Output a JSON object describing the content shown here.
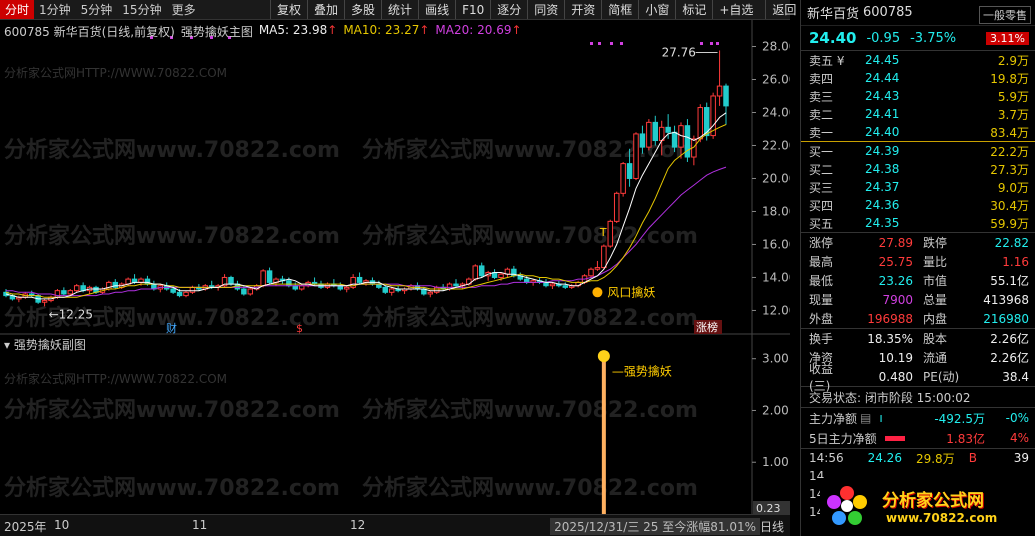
{
  "toolbar": {
    "periods": [
      "分时",
      "1分钟",
      "5分钟",
      "15分钟",
      "更多"
    ],
    "buttons": [
      "复权",
      "叠加",
      "多股",
      "统计",
      "画线",
      "F10",
      "逐分",
      "同资",
      "开资",
      "简框",
      "小窗",
      "标记",
      "+自选",
      "返回"
    ]
  },
  "chart": {
    "stock_label": "600785  新华百货(日线,前复权)",
    "formula_label": "强势擒妖主图",
    "ma5_label": "MA5: 23.98",
    "ma10_label": "MA10: 23.27",
    "ma20_label": "MA20: 20.69",
    "arrow": "↑",
    "high_label": "27.76",
    "low_label": "12.25",
    "signal_main": "风口擒妖",
    "signal_sub": "强势擒妖",
    "marker_t": "T",
    "sub_title": "强势擒妖副图",
    "event_cai": "财",
    "event_s": "$",
    "event_zhangbang": "涨榜",
    "sub_value": "0.23",
    "watermark_big": "分析家公式网www.70822.com",
    "watermark_small": "分析家公式网HTTP://WWW.70822.COM"
  },
  "chart_data": {
    "type": "candlestick",
    "y_ticks": [
      "28.00",
      "26.00",
      "24.00",
      "22.00",
      "20.00",
      "18.00",
      "16.00",
      "14.00",
      "12.00"
    ],
    "ylim": [
      11.3,
      29.0
    ],
    "sub_ticks": [
      "3.00",
      "2.00",
      "1.00"
    ],
    "sub_ylim": [
      0,
      3.4
    ],
    "x_labels": [
      "2025年",
      "10",
      "11",
      "12"
    ],
    "candles": [
      [
        13.1,
        13.3,
        12.8,
        12.9
      ],
      [
        12.9,
        13.0,
        12.6,
        12.7
      ],
      [
        12.7,
        12.9,
        12.5,
        12.8
      ],
      [
        12.8,
        13.1,
        12.7,
        13.0
      ],
      [
        13.0,
        13.2,
        12.8,
        12.9
      ],
      [
        12.9,
        13.0,
        12.4,
        12.5
      ],
      [
        12.5,
        12.7,
        12.25,
        12.6
      ],
      [
        12.6,
        12.9,
        12.5,
        12.8
      ],
      [
        12.8,
        13.3,
        12.7,
        13.2
      ],
      [
        13.2,
        13.4,
        12.9,
        13.0
      ],
      [
        13.0,
        13.3,
        12.9,
        13.2
      ],
      [
        13.2,
        13.6,
        13.1,
        13.5
      ],
      [
        13.5,
        13.7,
        13.1,
        13.2
      ],
      [
        13.2,
        13.5,
        13.0,
        13.4
      ],
      [
        13.4,
        13.5,
        13.0,
        13.1
      ],
      [
        13.1,
        13.4,
        13.0,
        13.3
      ],
      [
        13.3,
        13.8,
        13.2,
        13.7
      ],
      [
        13.7,
        13.9,
        13.3,
        13.4
      ],
      [
        13.4,
        13.7,
        13.3,
        13.6
      ],
      [
        13.6,
        14.0,
        13.5,
        13.9
      ],
      [
        13.9,
        14.2,
        13.6,
        13.7
      ],
      [
        13.7,
        14.0,
        13.5,
        13.9
      ],
      [
        13.9,
        14.1,
        13.5,
        13.6
      ],
      [
        13.6,
        13.8,
        13.2,
        13.3
      ],
      [
        13.3,
        13.6,
        13.1,
        13.5
      ],
      [
        13.5,
        13.7,
        13.2,
        13.3
      ],
      [
        13.3,
        13.5,
        13.0,
        13.1
      ],
      [
        13.1,
        13.3,
        12.8,
        12.9
      ],
      [
        12.9,
        13.2,
        12.8,
        13.1
      ],
      [
        13.1,
        13.5,
        13.0,
        13.4
      ],
      [
        13.4,
        13.6,
        13.2,
        13.3
      ],
      [
        13.3,
        13.6,
        13.2,
        13.5
      ],
      [
        13.5,
        13.8,
        13.3,
        13.4
      ],
      [
        13.4,
        13.6,
        13.2,
        13.5
      ],
      [
        13.5,
        14.2,
        13.4,
        14.0
      ],
      [
        14.0,
        14.1,
        13.5,
        13.6
      ],
      [
        13.6,
        13.8,
        13.2,
        13.3
      ],
      [
        13.3,
        13.5,
        12.9,
        13.0
      ],
      [
        13.0,
        13.4,
        12.9,
        13.3
      ],
      [
        13.3,
        13.6,
        13.2,
        13.5
      ],
      [
        13.5,
        14.5,
        13.4,
        14.4
      ],
      [
        14.4,
        14.6,
        13.6,
        13.7
      ],
      [
        13.7,
        14.0,
        13.5,
        13.9
      ],
      [
        13.9,
        14.1,
        13.6,
        13.8
      ],
      [
        13.8,
        14.0,
        13.4,
        13.5
      ],
      [
        13.5,
        13.7,
        13.2,
        13.3
      ],
      [
        13.3,
        13.6,
        13.2,
        13.5
      ],
      [
        13.5,
        13.8,
        13.4,
        13.7
      ],
      [
        13.7,
        14.0,
        13.5,
        13.6
      ],
      [
        13.6,
        13.8,
        13.3,
        13.4
      ],
      [
        13.4,
        13.7,
        13.3,
        13.6
      ],
      [
        13.6,
        13.9,
        13.4,
        13.5
      ],
      [
        13.5,
        13.7,
        13.2,
        13.3
      ],
      [
        13.3,
        13.5,
        13.1,
        13.4
      ],
      [
        13.4,
        14.2,
        13.3,
        14.0
      ],
      [
        14.0,
        14.3,
        13.6,
        13.7
      ],
      [
        13.7,
        13.9,
        13.5,
        13.8
      ],
      [
        13.8,
        14.0,
        13.5,
        13.6
      ],
      [
        13.6,
        13.8,
        13.3,
        13.4
      ],
      [
        13.4,
        13.5,
        13.0,
        13.1
      ],
      [
        13.1,
        13.4,
        12.9,
        13.3
      ],
      [
        13.3,
        13.5,
        13.1,
        13.2
      ],
      [
        13.2,
        13.4,
        13.0,
        13.3
      ],
      [
        13.3,
        13.6,
        13.2,
        13.5
      ],
      [
        13.5,
        13.7,
        13.2,
        13.3
      ],
      [
        13.3,
        13.4,
        12.9,
        13.0
      ],
      [
        13.0,
        13.2,
        12.8,
        13.1
      ],
      [
        13.1,
        13.5,
        13.0,
        13.4
      ],
      [
        13.4,
        13.6,
        13.2,
        13.3
      ],
      [
        13.3,
        13.7,
        13.2,
        13.6
      ],
      [
        13.6,
        13.9,
        13.4,
        13.5
      ],
      [
        13.5,
        13.7,
        13.3,
        13.6
      ],
      [
        13.6,
        14.0,
        13.5,
        13.9
      ],
      [
        13.9,
        14.8,
        13.8,
        14.7
      ],
      [
        14.7,
        14.9,
        14.0,
        14.1
      ],
      [
        14.1,
        14.4,
        13.8,
        14.3
      ],
      [
        14.3,
        14.5,
        13.9,
        14.0
      ],
      [
        14.0,
        14.3,
        13.8,
        14.2
      ],
      [
        14.2,
        14.6,
        14.0,
        14.5
      ],
      [
        14.5,
        14.7,
        14.0,
        14.1
      ],
      [
        14.1,
        14.3,
        13.8,
        13.9
      ],
      [
        13.9,
        14.1,
        13.6,
        13.7
      ],
      [
        13.7,
        13.9,
        13.5,
        13.8
      ],
      [
        13.8,
        14.0,
        13.6,
        13.7
      ],
      [
        13.7,
        13.9,
        13.4,
        13.5
      ],
      [
        13.5,
        13.7,
        13.3,
        13.6
      ],
      [
        13.6,
        13.8,
        13.4,
        13.5
      ],
      [
        13.5,
        13.7,
        13.3,
        13.4
      ],
      [
        13.4,
        13.6,
        13.3,
        13.5
      ],
      [
        13.5,
        13.8,
        13.4,
        13.7
      ],
      [
        13.7,
        14.2,
        13.6,
        14.1
      ],
      [
        14.1,
        14.6,
        14.0,
        14.5
      ],
      [
        14.5,
        15.0,
        14.4,
        14.6
      ],
      [
        14.6,
        16.0,
        14.5,
        15.9
      ],
      [
        15.9,
        17.5,
        15.8,
        17.4
      ],
      [
        17.4,
        19.2,
        17.3,
        19.1
      ],
      [
        19.1,
        21.0,
        18.9,
        20.9
      ],
      [
        20.9,
        21.8,
        19.5,
        20.0
      ],
      [
        20.0,
        22.8,
        19.9,
        22.7
      ],
      [
        22.7,
        23.2,
        21.5,
        21.9
      ],
      [
        21.9,
        23.6,
        21.7,
        23.4
      ],
      [
        23.4,
        23.8,
        22.0,
        22.3
      ],
      [
        22.3,
        23.5,
        21.4,
        23.1
      ],
      [
        23.1,
        23.9,
        22.4,
        22.8
      ],
      [
        22.8,
        23.2,
        21.6,
        21.9
      ],
      [
        21.9,
        23.4,
        21.2,
        23.2
      ],
      [
        23.2,
        23.6,
        21.0,
        21.3
      ],
      [
        21.3,
        22.6,
        20.8,
        22.4
      ],
      [
        22.4,
        24.5,
        22.2,
        24.3
      ],
      [
        24.3,
        24.6,
        22.3,
        22.6
      ],
      [
        22.6,
        25.2,
        22.4,
        25.0
      ],
      [
        25.0,
        27.76,
        24.4,
        25.6
      ],
      [
        25.6,
        25.75,
        23.26,
        24.4
      ]
    ],
    "ma5": [
      13.0,
      12.9,
      12.8,
      12.8,
      12.8,
      12.7,
      12.7,
      12.7,
      12.8,
      12.8,
      12.9,
      13.1,
      13.2,
      13.3,
      13.3,
      13.3,
      13.4,
      13.5,
      13.5,
      13.6,
      13.7,
      13.7,
      13.7,
      13.6,
      13.6,
      13.5,
      13.4,
      13.2,
      13.2,
      13.2,
      13.2,
      13.3,
      13.4,
      13.4,
      13.6,
      13.6,
      13.6,
      13.5,
      13.4,
      13.3,
      13.5,
      13.6,
      13.7,
      13.8,
      13.9,
      13.8,
      13.6,
      13.6,
      13.5,
      13.5,
      13.5,
      13.5,
      13.5,
      13.5,
      13.6,
      13.6,
      13.7,
      13.7,
      13.7,
      13.5,
      13.4,
      13.3,
      13.3,
      13.3,
      13.3,
      13.3,
      13.2,
      13.2,
      13.2,
      13.3,
      13.4,
      13.5,
      13.6,
      13.9,
      14.0,
      14.2,
      14.3,
      14.3,
      14.2,
      14.2,
      14.1,
      14.0,
      13.9,
      13.8,
      13.7,
      13.7,
      13.6,
      13.6,
      13.5,
      13.5,
      13.7,
      13.9,
      14.1,
      14.5,
      15.2,
      16.0,
      17.1,
      18.2,
      19.4,
      20.2,
      20.9,
      21.6,
      22.3,
      22.7,
      22.8,
      22.6,
      22.5,
      22.3,
      22.5,
      22.8,
      23.2,
      23.7,
      23.98
    ],
    "ma10": [
      13.1,
      13.0,
      13.0,
      12.9,
      12.9,
      12.9,
      12.8,
      12.8,
      12.8,
      12.8,
      12.8,
      12.8,
      12.9,
      13.0,
      13.1,
      13.2,
      13.3,
      13.3,
      13.4,
      13.5,
      13.5,
      13.6,
      13.6,
      13.6,
      13.6,
      13.5,
      13.5,
      13.4,
      13.4,
      13.4,
      13.4,
      13.4,
      13.4,
      13.4,
      13.4,
      13.4,
      13.5,
      13.5,
      13.5,
      13.5,
      13.5,
      13.6,
      13.6,
      13.6,
      13.6,
      13.6,
      13.6,
      13.6,
      13.6,
      13.6,
      13.6,
      13.6,
      13.6,
      13.5,
      13.5,
      13.6,
      13.6,
      13.6,
      13.6,
      13.6,
      13.5,
      13.5,
      13.5,
      13.4,
      13.4,
      13.4,
      13.3,
      13.3,
      13.3,
      13.3,
      13.3,
      13.3,
      13.4,
      13.5,
      13.6,
      13.7,
      13.8,
      13.9,
      14.0,
      14.1,
      14.2,
      14.1,
      14.1,
      14.0,
      14.0,
      13.9,
      13.9,
      13.8,
      13.7,
      13.7,
      13.7,
      13.8,
      13.8,
      14.0,
      14.3,
      14.7,
      15.2,
      15.8,
      16.5,
      17.3,
      18.0,
      18.8,
      19.7,
      20.6,
      21.1,
      21.4,
      21.7,
      21.9,
      22.4,
      22.7,
      22.9,
      23.1,
      23.27
    ],
    "ma20": [
      13.2,
      13.2,
      13.1,
      13.1,
      13.1,
      13.0,
      13.0,
      13.0,
      12.9,
      12.9,
      12.9,
      12.9,
      12.9,
      12.9,
      12.9,
      13.0,
      13.0,
      13.1,
      13.1,
      13.2,
      13.2,
      13.3,
      13.3,
      13.3,
      13.4,
      13.4,
      13.4,
      13.4,
      13.4,
      13.4,
      13.4,
      13.4,
      13.4,
      13.4,
      13.4,
      13.4,
      13.4,
      13.4,
      13.4,
      13.4,
      13.5,
      13.5,
      13.5,
      13.5,
      13.5,
      13.5,
      13.5,
      13.5,
      13.5,
      13.5,
      13.5,
      13.5,
      13.5,
      13.5,
      13.6,
      13.6,
      13.6,
      13.6,
      13.6,
      13.6,
      13.6,
      13.6,
      13.5,
      13.5,
      13.5,
      13.5,
      13.5,
      13.4,
      13.4,
      13.4,
      13.4,
      13.4,
      13.4,
      13.4,
      13.5,
      13.5,
      13.5,
      13.6,
      13.6,
      13.7,
      13.7,
      13.7,
      13.7,
      13.7,
      13.7,
      13.8,
      13.8,
      13.8,
      13.8,
      13.9,
      13.9,
      14.0,
      14.1,
      14.3,
      14.5,
      14.8,
      15.2,
      15.6,
      16.0,
      16.5,
      17.0,
      17.4,
      17.8,
      18.2,
      18.6,
      19.0,
      19.3,
      19.6,
      19.9,
      20.2,
      20.4,
      20.55,
      20.69
    ]
  },
  "status_bar": {
    "date_info": "2025/12/31/三  25  至今涨幅81.01%",
    "line_btn": "日线"
  },
  "side": {
    "name": "新华百货",
    "code": "600785",
    "mode_btn": "一般零售",
    "price": "24.40",
    "change": "-0.95",
    "pct": "-3.75%",
    "badge": "3.11%",
    "sells": [
      {
        "label": "卖五 ¥",
        "price": "24.45",
        "vol": "2.9万"
      },
      {
        "label": "卖四",
        "price": "24.44",
        "vol": "19.8万"
      },
      {
        "label": "卖三",
        "price": "24.43",
        "vol": "5.9万"
      },
      {
        "label": "卖二",
        "price": "24.41",
        "vol": "3.7万"
      },
      {
        "label": "卖一",
        "price": "24.40",
        "vol": "83.4万"
      }
    ],
    "buys": [
      {
        "label": "买一",
        "price": "24.39",
        "vol": "22.2万"
      },
      {
        "label": "买二",
        "price": "24.38",
        "vol": "27.3万"
      },
      {
        "label": "买三",
        "price": "24.37",
        "vol": "9.0万"
      },
      {
        "label": "买四",
        "price": "24.36",
        "vol": "30.4万"
      },
      {
        "label": "买五",
        "price": "24.35",
        "vol": "59.9万"
      }
    ],
    "stats1": [
      {
        "l1": "涨停",
        "v1": "27.89",
        "l2": "跌停",
        "v2": "22.82"
      },
      {
        "l1": "最高",
        "v1": "25.75",
        "l2": "量比",
        "v2": "1.16"
      },
      {
        "l1": "最低",
        "v1": "23.26",
        "l2": "市值",
        "v2": "55.1亿"
      },
      {
        "l1": "现量",
        "v1": "7900",
        "l2": "总量",
        "v2": "413968"
      },
      {
        "l1": "外盘",
        "v1": "196988",
        "l2": "内盘",
        "v2": "216980"
      }
    ],
    "stats2": [
      {
        "l1": "换手",
        "v1": "18.35%",
        "l2": "股本",
        "v2": "2.26亿"
      },
      {
        "l1": "净资",
        "v1": "10.19",
        "l2": "流通",
        "v2": "2.26亿"
      },
      {
        "l1": "收益(三)",
        "v1": "0.480",
        "l2": "PE(动)",
        "v2": "38.4"
      }
    ],
    "trade_status": "交易状态: 闭市阶段 15:00:02",
    "net1_label": "主力净额",
    "net1_val": "-492.5万",
    "net1_pct": "-0%",
    "net5_label": "5日主力净额",
    "net5_val": "1.83亿",
    "net5_pct": "4%",
    "ticks": [
      {
        "t": "14:56",
        "p": "24.26",
        "v": "29.8万",
        "f": "B",
        "n": "39"
      },
      {
        "t": "14",
        "p": "",
        "v": "",
        "f": "",
        "n": ""
      },
      {
        "t": "14",
        "p": "",
        "v": "",
        "f": "",
        "n": ""
      },
      {
        "t": "14",
        "p": "",
        "v": "",
        "f": "",
        "n": ""
      }
    ],
    "logo_text": "分析家公式网",
    "logo_url": "www.70822.com"
  },
  "colors": {
    "up": "#ff3b3b",
    "down": "#22cccc",
    "ma5": "#ffffff",
    "ma10": "#e6c700",
    "ma20": "#b030e0"
  }
}
